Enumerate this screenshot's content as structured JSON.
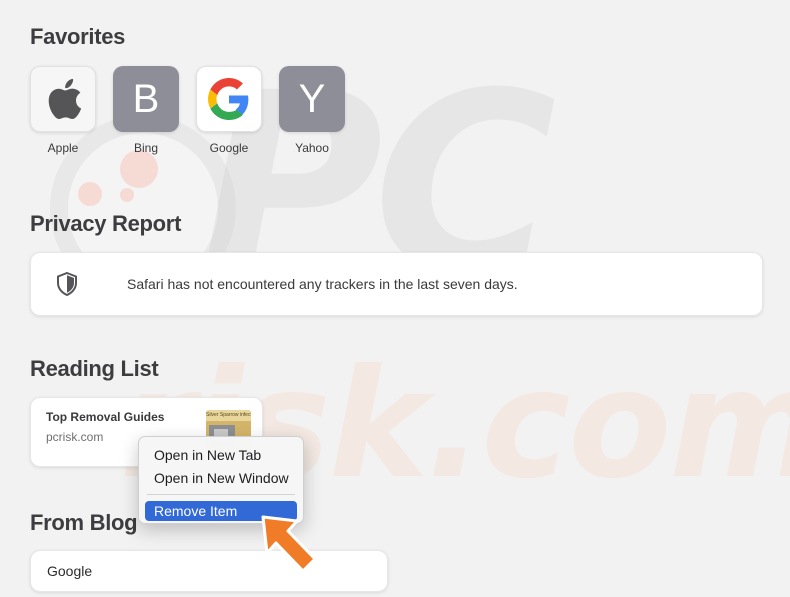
{
  "favorites": {
    "title": "Favorites",
    "items": [
      {
        "label": "Apple",
        "icon": "apple-logo-icon"
      },
      {
        "label": "Bing",
        "letter": "B"
      },
      {
        "label": "Google",
        "icon": "google-logo-icon"
      },
      {
        "label": "Yahoo",
        "letter": "Y"
      }
    ]
  },
  "privacy": {
    "title": "Privacy Report",
    "message": "Safari has not encountered any trackers in the last seven days.",
    "icon": "shield-icon"
  },
  "reading_list": {
    "title": "Reading List",
    "items": [
      {
        "title": "Top Removal Guides",
        "url": "pcrisk.com",
        "thumbnail_caption": "Silver Sparrow infect"
      }
    ]
  },
  "blog": {
    "title": "From Blog",
    "items": [
      {
        "title": "Google"
      }
    ]
  },
  "context_menu": {
    "items": [
      {
        "label": "Open in New Tab"
      },
      {
        "label": "Open in New Window"
      },
      {
        "label": "Remove Item",
        "selected": true
      }
    ]
  },
  "watermark": {
    "primary": "PC",
    "secondary": "risk.com"
  },
  "colors": {
    "background": "#f2f2f2",
    "menu_highlight": "#3169d7",
    "arrow": "#f07c27",
    "tile_gray": "#8d8e98"
  }
}
